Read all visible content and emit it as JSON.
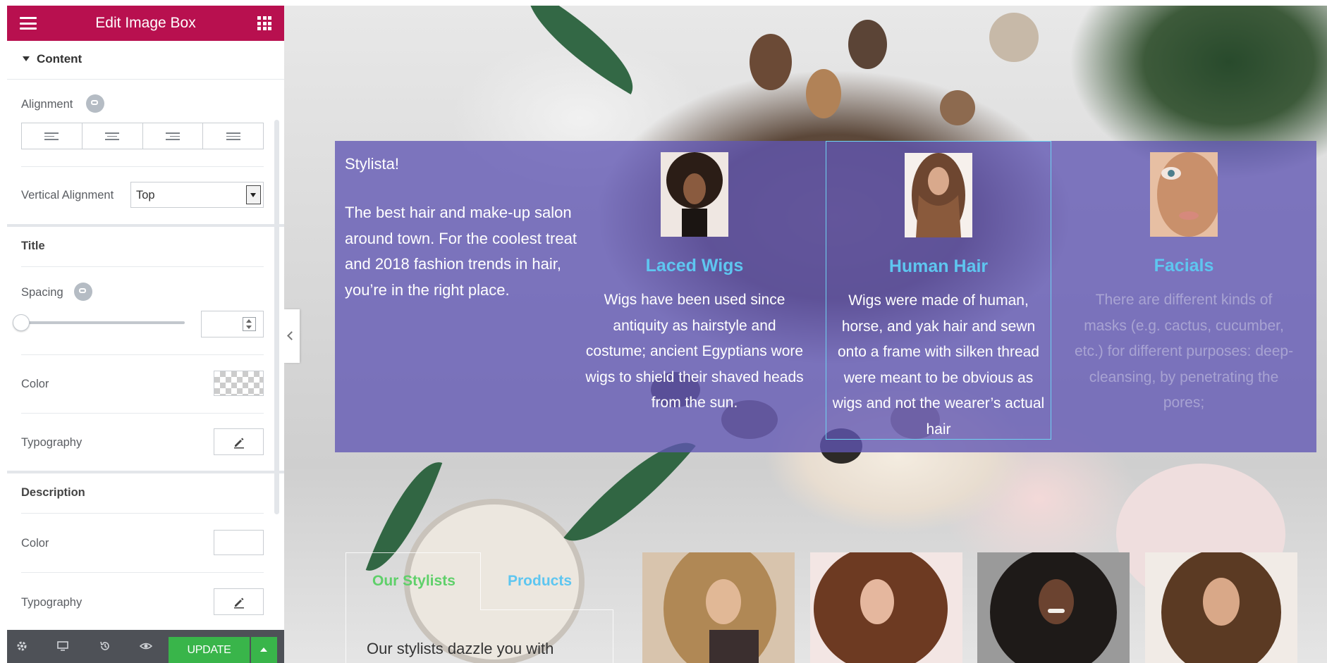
{
  "panel": {
    "header_title": "Edit Image Box",
    "section": "Content",
    "alignment_label": "Alignment",
    "vertical_alignment_label": "Vertical Alignment",
    "vertical_alignment_value": "Top",
    "title_section": "Title",
    "spacing_label": "Spacing",
    "title_color_label": "Color",
    "title_typography_label": "Typography",
    "description_section": "Description",
    "description_color_label": "Color",
    "description_typography_label": "Typography",
    "footer": {
      "update_label": "UPDATE"
    }
  },
  "preview": {
    "intro_heading": "Stylista!",
    "intro_text": "The best hair and make-up salon around town. For the coolest treat and 2018 fashion trends in hair, you’re in the right place.",
    "boxes": [
      {
        "title": "Laced Wigs",
        "description": "Wigs have been used since antiquity as hairstyle and costume; ancient Egyptians wore wigs to shield their shaved heads from the sun."
      },
      {
        "title": "Human Hair",
        "description": "Wigs were made of human, horse, and yak hair and sewn onto a frame with silken thread were meant to be obvious as wigs and not the wearer’s actual hair"
      },
      {
        "title": "Facials",
        "description": "There are different kinds of masks (e.g. cactus, cucumber, etc.) for different purposes: deep-cleansing, by penetrating the pores;"
      }
    ],
    "tabs": [
      "Our Stylists",
      "Products"
    ],
    "tab_content": "Our stylists dazzle you with"
  },
  "colors": {
    "header_bg": "#b8104f",
    "band_overlay": "#6056b4",
    "box_title": "#5ec6f0",
    "tab_active": "#5fd06a",
    "update_green": "#39b54a",
    "footer_bg": "#4e5157"
  },
  "icons": {
    "menu": "hamburger-icon",
    "apps": "grid-icon",
    "info": "responsive-icon",
    "edit": "pencil-icon",
    "settings": "gear-icon",
    "responsive": "desktop-icon",
    "history": "history-icon",
    "preview": "eye-icon"
  }
}
